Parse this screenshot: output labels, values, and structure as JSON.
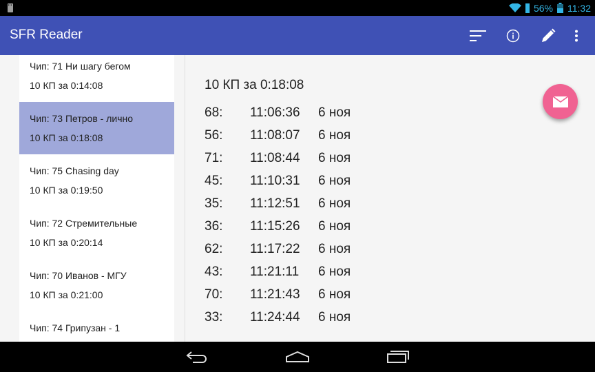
{
  "status_bar": {
    "battery_text": "56%",
    "time": "11:32",
    "icons": [
      "sd-card-icon",
      "wifi-icon",
      "signal-icon",
      "battery-icon"
    ]
  },
  "app_bar": {
    "title": "SFR Reader",
    "actions": [
      "sort-icon",
      "info-icon",
      "edit-icon",
      "overflow-menu-icon"
    ]
  },
  "list": {
    "items": [
      {
        "title": "Чип: 71  Ни шагу бегом",
        "subtitle": "10 КП за 0:14:08"
      },
      {
        "title": "Чип: 73  Петров - лично",
        "subtitle": "10 КП за 0:18:08",
        "selected": true
      },
      {
        "title": "Чип: 75  Chasing day",
        "subtitle": "10 КП за 0:19:50"
      },
      {
        "title": "Чип: 72  Стремительные",
        "subtitle": "10 КП за 0:20:14"
      },
      {
        "title": "Чип: 70  Иванов - МГУ",
        "subtitle": "10 КП за 0:21:00"
      },
      {
        "title": "Чип: 74  Грипузан - 1",
        "subtitle": ""
      }
    ]
  },
  "detail": {
    "summary": "10 КП за 0:18:08",
    "punches": [
      {
        "cp": "68:",
        "time": "11:06:36",
        "date": "6 ноя"
      },
      {
        "cp": "56:",
        "time": "11:08:07",
        "date": "6 ноя"
      },
      {
        "cp": "71:",
        "time": "11:08:44",
        "date": "6 ноя"
      },
      {
        "cp": "45:",
        "time": "11:10:31",
        "date": "6 ноя"
      },
      {
        "cp": "35:",
        "time": "11:12:51",
        "date": "6 ноя"
      },
      {
        "cp": "36:",
        "time": "11:15:26",
        "date": "6 ноя"
      },
      {
        "cp": "62:",
        "time": "11:17:22",
        "date": "6 ноя"
      },
      {
        "cp": "43:",
        "time": "11:21:11",
        "date": "6 ноя"
      },
      {
        "cp": "70:",
        "time": "11:21:43",
        "date": "6 ноя"
      },
      {
        "cp": "33:",
        "time": "11:24:44",
        "date": "6 ноя"
      }
    ]
  },
  "fab": {
    "icon": "mail-icon"
  },
  "nav_bar": {
    "buttons": [
      "back-icon",
      "home-icon",
      "recents-icon"
    ]
  },
  "colors": {
    "primary": "#3f51b5",
    "selected_row": "#9fa8da",
    "fab": "#f06292",
    "status_accent": "#33b5e5"
  }
}
